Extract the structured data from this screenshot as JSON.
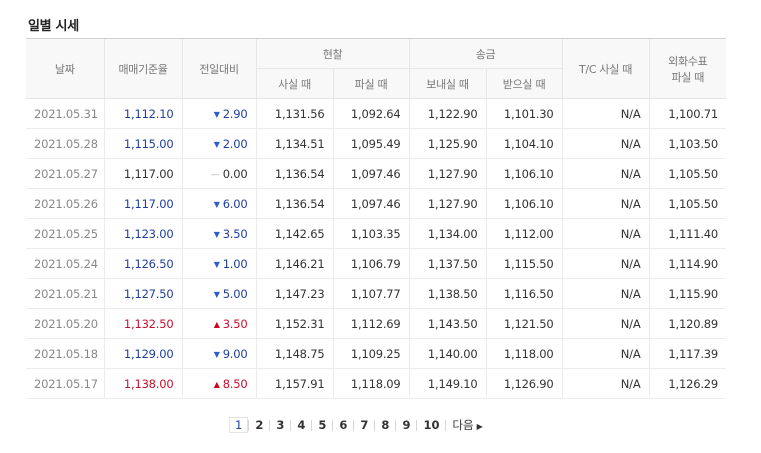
{
  "title": "일별 시세",
  "headers": {
    "date": "날짜",
    "base_rate": "매매기준율",
    "change": "전일대비",
    "cash_group": "현찰",
    "cash_buy": "사실 때",
    "cash_sell": "파실 때",
    "remit_group": "송금",
    "remit_send": "보내실 때",
    "remit_receive": "받으실 때",
    "tc_buy": "T/C 사실 때",
    "fx_check_line1": "외화수표",
    "fx_check_line2": "파실 때"
  },
  "rows": [
    {
      "date": "2021.05.31",
      "base": "1,112.10",
      "direction": "down",
      "change": "2.90",
      "cash_buy": "1,131.56",
      "cash_sell": "1,092.64",
      "send": "1,122.90",
      "receive": "1,101.30",
      "tc": "N/A",
      "check": "1,100.71"
    },
    {
      "date": "2021.05.28",
      "base": "1,115.00",
      "direction": "down",
      "change": "2.00",
      "cash_buy": "1,134.51",
      "cash_sell": "1,095.49",
      "send": "1,125.90",
      "receive": "1,104.10",
      "tc": "N/A",
      "check": "1,103.50"
    },
    {
      "date": "2021.05.27",
      "base": "1,117.00",
      "direction": "flat",
      "change": "0.00",
      "cash_buy": "1,136.54",
      "cash_sell": "1,097.46",
      "send": "1,127.90",
      "receive": "1,106.10",
      "tc": "N/A",
      "check": "1,105.50"
    },
    {
      "date": "2021.05.26",
      "base": "1,117.00",
      "direction": "down",
      "change": "6.00",
      "cash_buy": "1,136.54",
      "cash_sell": "1,097.46",
      "send": "1,127.90",
      "receive": "1,106.10",
      "tc": "N/A",
      "check": "1,105.50"
    },
    {
      "date": "2021.05.25",
      "base": "1,123.00",
      "direction": "down",
      "change": "3.50",
      "cash_buy": "1,142.65",
      "cash_sell": "1,103.35",
      "send": "1,134.00",
      "receive": "1,112.00",
      "tc": "N/A",
      "check": "1,111.40"
    },
    {
      "date": "2021.05.24",
      "base": "1,126.50",
      "direction": "down",
      "change": "1.00",
      "cash_buy": "1,146.21",
      "cash_sell": "1,106.79",
      "send": "1,137.50",
      "receive": "1,115.50",
      "tc": "N/A",
      "check": "1,114.90"
    },
    {
      "date": "2021.05.21",
      "base": "1,127.50",
      "direction": "down",
      "change": "5.00",
      "cash_buy": "1,147.23",
      "cash_sell": "1,107.77",
      "send": "1,138.50",
      "receive": "1,116.50",
      "tc": "N/A",
      "check": "1,115.90"
    },
    {
      "date": "2021.05.20",
      "base": "1,132.50",
      "direction": "up",
      "change": "3.50",
      "cash_buy": "1,152.31",
      "cash_sell": "1,112.69",
      "send": "1,143.50",
      "receive": "1,121.50",
      "tc": "N/A",
      "check": "1,120.89"
    },
    {
      "date": "2021.05.18",
      "base": "1,129.00",
      "direction": "down",
      "change": "9.00",
      "cash_buy": "1,148.75",
      "cash_sell": "1,109.25",
      "send": "1,140.00",
      "receive": "1,118.00",
      "tc": "N/A",
      "check": "1,117.39"
    },
    {
      "date": "2021.05.17",
      "base": "1,138.00",
      "direction": "up",
      "change": "8.50",
      "cash_buy": "1,157.91",
      "cash_sell": "1,118.09",
      "send": "1,149.10",
      "receive": "1,126.90",
      "tc": "N/A",
      "check": "1,126.29"
    }
  ],
  "pagination": {
    "pages": [
      "1",
      "2",
      "3",
      "4",
      "5",
      "6",
      "7",
      "8",
      "9",
      "10"
    ],
    "current": "1",
    "next_label": "다음"
  },
  "icons": {
    "down": "triangle-down-icon",
    "up": "triangle-up-icon",
    "flat": "dash-icon",
    "next": "chevron-right-icon"
  },
  "colors": {
    "up": "#c8102e",
    "down": "#1f3f9e",
    "header_bg": "#f8f8f9"
  }
}
